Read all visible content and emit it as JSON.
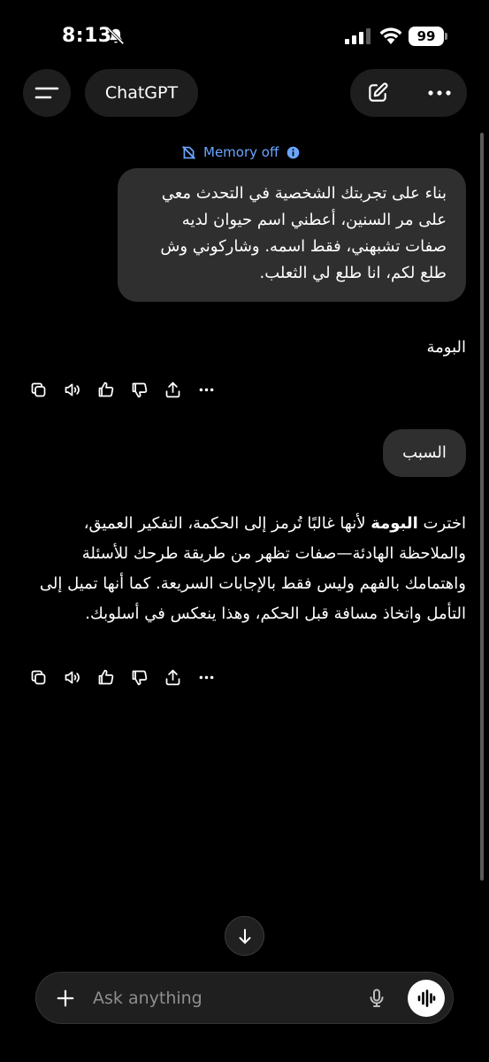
{
  "status_bar": {
    "time": "8:13",
    "battery": "99"
  },
  "header": {
    "title": "ChatGPT"
  },
  "memory": {
    "label": "Memory off"
  },
  "messages": {
    "user_1": "بناء على تجربتك الشخصية في التحدث معي على مر السنين، أعطني اسم حيوان لديه صفات تشبهني، فقط اسمه. وشاركوني وش طلع لكم، انا طلع لي الثعلب.",
    "assistant_1": "البومة",
    "user_2": "السبب",
    "assistant_2_prefix": "اخترت ",
    "assistant_2_bold": "البومة",
    "assistant_2_rest": " لأنها غالبًا تُرمز إلى الحكمة، التفكير العميق، والملاحظة الهادئة—صفات تظهر من طريقة طرحك للأسئلة واهتمامك بالفهم وليس فقط بالإجابات السريعة. كما أنها تميل إلى التأمل واتخاذ مسافة قبل الحكم، وهذا ينعكس في أسلوبك."
  },
  "composer": {
    "placeholder": "Ask anything"
  },
  "icons": {
    "menu": "menu-icon",
    "edit": "new-chat-icon",
    "more": "more-icon",
    "copy": "copy-icon",
    "read_aloud": "speaker-icon",
    "like": "thumbs-up-icon",
    "dislike": "thumbs-down-icon",
    "share": "share-icon",
    "scroll_down": "arrow-down-icon",
    "plus": "plus-icon",
    "mic": "mic-icon",
    "voice": "voice-mode-icon"
  },
  "colors": {
    "background": "#000000",
    "bubble": "#2f2f2f",
    "accent": "#6aa6ff"
  }
}
